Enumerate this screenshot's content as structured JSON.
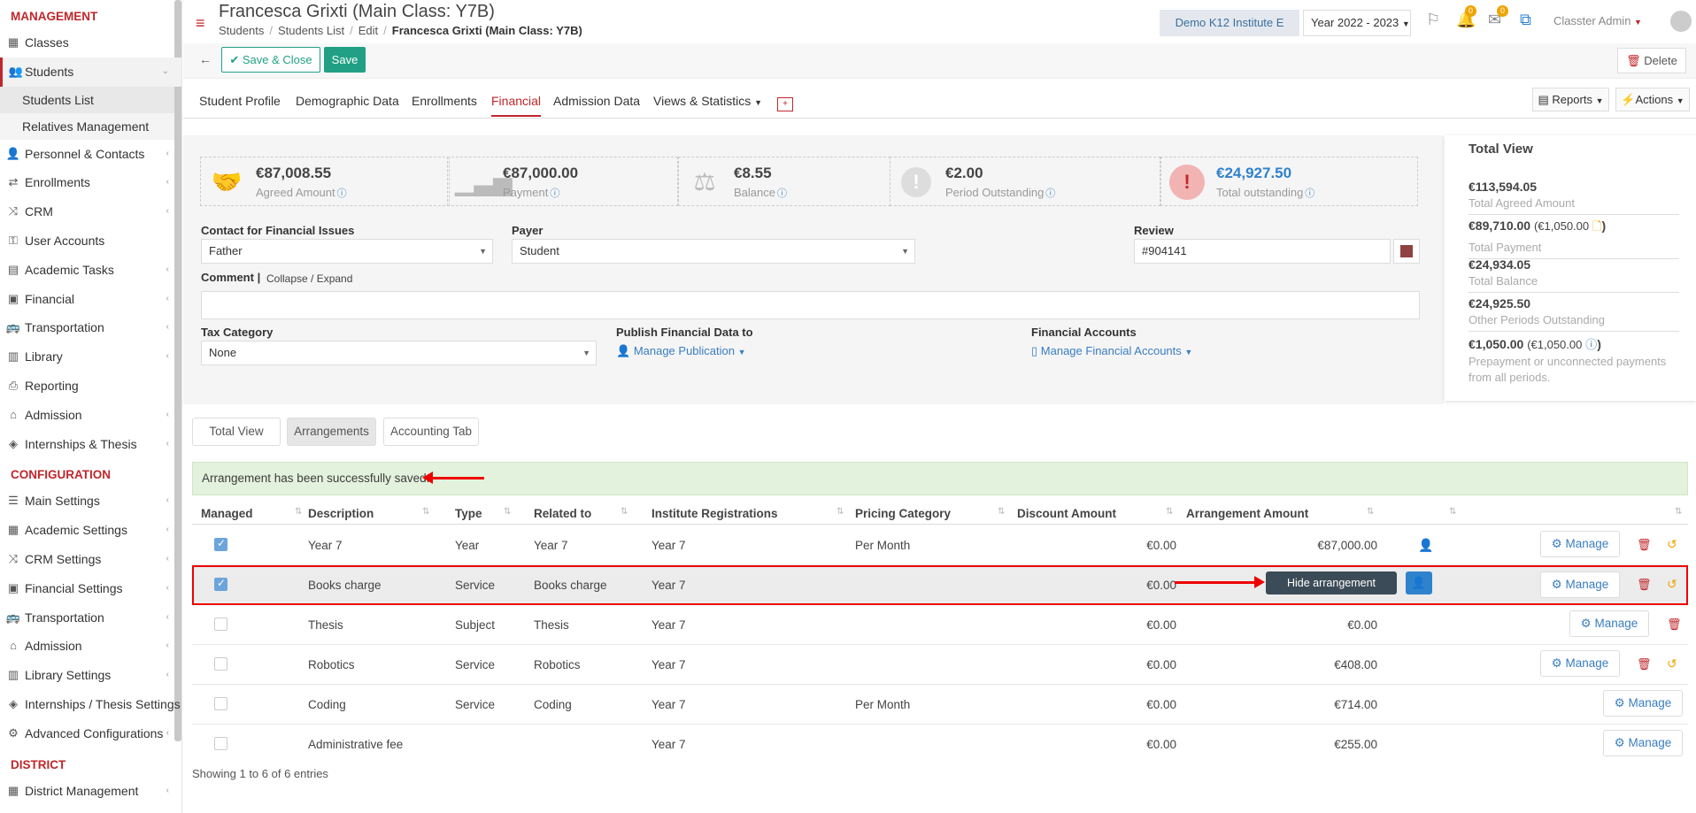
{
  "sidebar": {
    "section_management": "MANAGEMENT",
    "section_configuration": "CONFIGURATION",
    "section_district": "DISTRICT",
    "management_items": [
      {
        "label": "Classes",
        "icon": "classes-icon"
      },
      {
        "label": "Students",
        "icon": "students-icon"
      },
      {
        "label": "Personnel & Contacts",
        "icon": "personnel-icon"
      },
      {
        "label": "Enrollments",
        "icon": "enrollments-icon"
      },
      {
        "label": "CRM",
        "icon": "crm-icon"
      },
      {
        "label": "User Accounts",
        "icon": "key-icon"
      },
      {
        "label": "Academic Tasks",
        "icon": "tasks-icon"
      },
      {
        "label": "Financial",
        "icon": "financial-icon"
      },
      {
        "label": "Transportation",
        "icon": "bus-icon"
      },
      {
        "label": "Library",
        "icon": "library-icon"
      },
      {
        "label": "Reporting",
        "icon": "printer-icon"
      },
      {
        "label": "Admission",
        "icon": "bank-icon"
      },
      {
        "label": "Internships & Thesis",
        "icon": "cube-icon"
      }
    ],
    "student_subitems": [
      "Students List",
      "Relatives Management"
    ],
    "configuration_items": [
      {
        "label": "Main Settings"
      },
      {
        "label": "Academic Settings"
      },
      {
        "label": "CRM Settings"
      },
      {
        "label": "Financial Settings"
      },
      {
        "label": "Transportation"
      },
      {
        "label": "Admission"
      },
      {
        "label": "Library Settings"
      },
      {
        "label": "Internships / Thesis Settings"
      },
      {
        "label": "Advanced Configurations"
      }
    ],
    "district_items": [
      {
        "label": "District Management"
      }
    ]
  },
  "header": {
    "title": "Francesca Grixti (Main Class: Y7B)",
    "breadcrumb": [
      "Students",
      "Students List",
      "Edit",
      "Francesca Grixti (Main Class: Y7B)"
    ],
    "institute": "Demo K12 Institute E",
    "year": "Year 2022 - 2023",
    "notif_count": "0",
    "mail_count": "0",
    "user": "Classter Admin"
  },
  "toolbar": {
    "save_close": "Save & Close",
    "save": "Save",
    "delete": "Delete"
  },
  "tabs": [
    "Student Profile",
    "Demographic Data",
    "Enrollments",
    "Financial",
    "Admission Data",
    "Views & Statistics"
  ],
  "reports_label": "Reports",
  "actions_label": "Actions",
  "kpis": [
    {
      "value": "€87,008.55",
      "label": "Agreed Amount"
    },
    {
      "value": "€87,000.00",
      "label": "Payment"
    },
    {
      "value": "€8.55",
      "label": "Balance"
    },
    {
      "value": "€2.00",
      "label": "Period Outstanding"
    },
    {
      "value": "€24,927.50",
      "label": "Total outstanding"
    }
  ],
  "form": {
    "contact_label": "Contact for Financial Issues",
    "contact_value": "Father",
    "payer_label": "Payer",
    "payer_value": "Student",
    "review_label": "Review",
    "review_value": "#904141",
    "comment_label": "Comment",
    "collapse_label": "Collapse / Expand",
    "tax_label": "Tax Category",
    "tax_value": "None",
    "publish_label": "Publish Financial Data to",
    "publish_link": "Manage Publication",
    "accounts_label": "Financial Accounts",
    "accounts_link": "Manage Financial Accounts"
  },
  "total_view": {
    "title": "Total View",
    "agreed": "€113,594.05",
    "agreed_label": "Total Agreed Amount",
    "payment": "€89,710.00",
    "payment_extra": "(€1,050.00",
    "payment_label": "Total Payment",
    "balance": "€24,934.05",
    "balance_label": "Total Balance",
    "other": "€24,925.50",
    "other_label": "Other Periods Outstanding",
    "prepay": "€1,050.00",
    "prepay_extra": "(€1,050.00",
    "prepay_label": "Prepayment or unconnected payments from all periods."
  },
  "subtabs": [
    "Total View",
    "Arrangements",
    "Accounting Tab"
  ],
  "alert": "Arrangement has been successfully saved.",
  "table": {
    "headers": [
      "Managed",
      "Description",
      "Type",
      "Related to",
      "Institute Registrations",
      "Pricing Category",
      "Discount Amount",
      "Arrangement Amount"
    ],
    "rows": [
      {
        "checked": true,
        "desc": "Year 7",
        "type": "Year",
        "related": "Year 7",
        "reg": "Year 7",
        "pricing": "Per Month",
        "discount": "€0.00",
        "amount": "€87,000.00"
      },
      {
        "checked": true,
        "desc": "Books charge",
        "type": "Service",
        "related": "Books charge",
        "reg": "Year 7",
        "pricing": "",
        "discount": "€0.00",
        "amount": ""
      },
      {
        "checked": false,
        "desc": "Thesis",
        "type": "Subject",
        "related": "Thesis",
        "reg": "Year 7",
        "pricing": "",
        "discount": "€0.00",
        "amount": "€0.00"
      },
      {
        "checked": false,
        "desc": "Robotics",
        "type": "Service",
        "related": "Robotics",
        "reg": "Year 7",
        "pricing": "",
        "discount": "€0.00",
        "amount": "€408.00"
      },
      {
        "checked": false,
        "desc": "Coding",
        "type": "Service",
        "related": "Coding",
        "reg": "Year 7",
        "pricing": "Per Month",
        "discount": "€0.00",
        "amount": "€714.00"
      },
      {
        "checked": false,
        "desc": "Administrative fee",
        "type": "",
        "related": "",
        "reg": "Year 7",
        "pricing": "",
        "discount": "€0.00",
        "amount": "€255.00"
      }
    ],
    "manage_label": "Manage",
    "tooltip": "Hide arrangement",
    "showing": "Showing 1 to 6 of 6 entries"
  }
}
